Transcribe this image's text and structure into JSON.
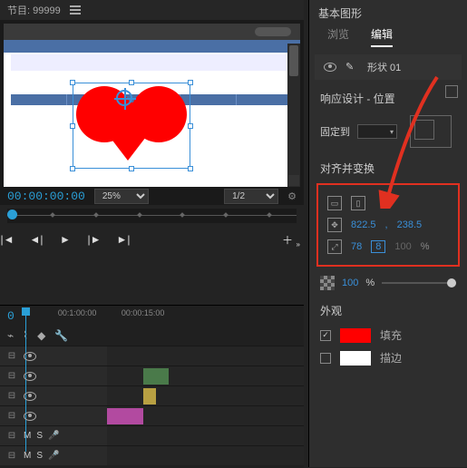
{
  "header": {
    "project_label": "节目: 99999"
  },
  "preview": {
    "timecode": "00:00:00:00",
    "zoom": "25%",
    "view": "1/2",
    "ruler_ticks": 7
  },
  "transport": {
    "prev_mark": "|◄",
    "step_back": "◄|",
    "play": "►",
    "step_fwd": "|►",
    "next_mark": "►|",
    "add": "＋"
  },
  "timeline": {
    "timecode": "0",
    "marks": [
      "00:1:00:00",
      "00:00:15:00"
    ],
    "tools": {
      "snap": "⌁",
      "link": "⌇",
      "marker": "◆",
      "wrench": "🔧"
    },
    "audio_labels": {
      "m": "M",
      "s": "S"
    }
  },
  "panel": {
    "title": "基本图形",
    "tabs": {
      "browse": "浏览",
      "edit": "编辑"
    },
    "layer": {
      "name": "形状 01"
    },
    "responsive": {
      "heading": "响应设计 - 位置",
      "pin_label": "固定到",
      "pin_dropdown": "▾"
    },
    "align": {
      "heading": "对齐并变换",
      "pos_x": "822.5",
      "pos_sep": ",",
      "pos_y": "238.5",
      "scale_w": "78",
      "scale_h": "8",
      "scale_h_full": "100",
      "pct": "%"
    },
    "opacity": {
      "value": "100",
      "pct": "%"
    },
    "appearance": {
      "heading": "外观",
      "fill": "填充",
      "stroke": "描边"
    }
  }
}
